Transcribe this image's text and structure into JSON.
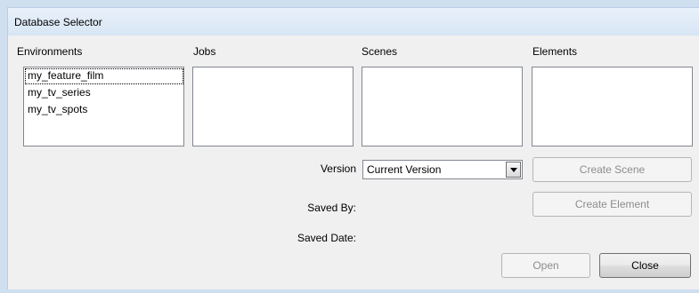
{
  "window": {
    "title": "Database Selector"
  },
  "columns": {
    "environments": {
      "label": "Environments",
      "items": [
        "my_feature_film",
        "my_tv_series",
        "my_tv_spots"
      ]
    },
    "jobs": {
      "label": "Jobs",
      "items": []
    },
    "scenes": {
      "label": "Scenes",
      "items": []
    },
    "elements": {
      "label": "Elements",
      "items": []
    }
  },
  "fields": {
    "version_label": "Version",
    "version_value": "Current Version",
    "saved_by_label": "Saved By:",
    "saved_by_value": "",
    "saved_date_label": "Saved Date:",
    "saved_date_value": ""
  },
  "buttons": {
    "create_scene": "Create Scene",
    "create_element": "Create Element",
    "open": "Open",
    "close": "Close"
  },
  "colors": {
    "title_bar": "#dbe7f5",
    "client_bg": "#f0f0f0",
    "disabled_text": "#8d8d8d"
  },
  "icons": {
    "dropdown": "chevron-down-icon"
  }
}
